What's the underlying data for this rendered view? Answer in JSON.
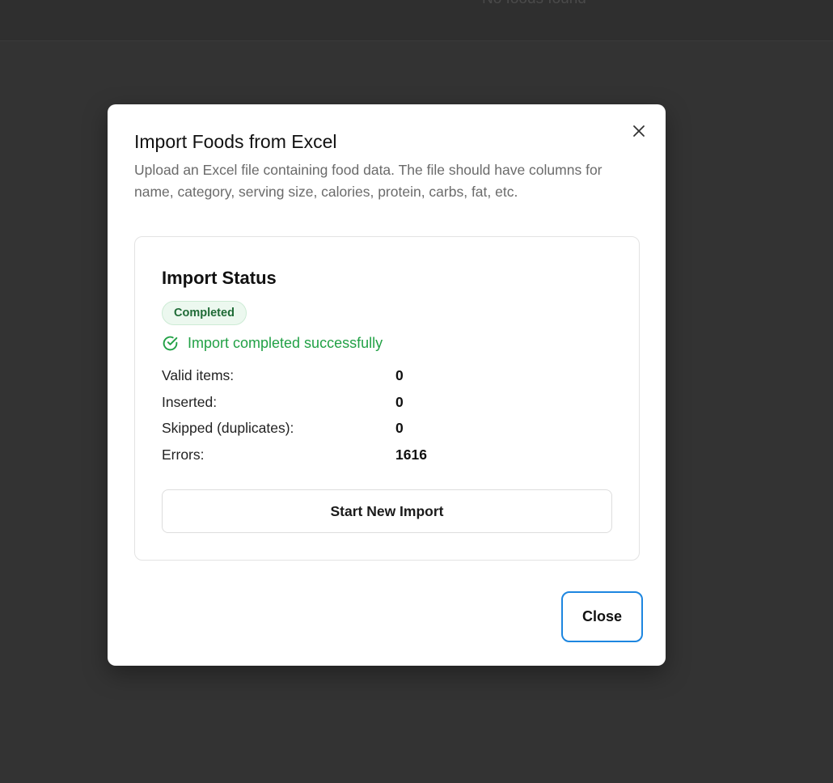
{
  "background": {
    "empty_text": "No foods found"
  },
  "dialog": {
    "title": "Import Foods from Excel",
    "description": "Upload an Excel file containing food data. The file should have columns for name, category, serving size, calories, protein, carbs, fat, etc.",
    "close_icon": "close-icon",
    "status_card": {
      "title": "Import Status",
      "badge": "Completed",
      "success_icon": "check-circle-icon",
      "success_message": "Import completed successfully",
      "stats": [
        {
          "label": "Valid items:",
          "value": "0"
        },
        {
          "label": "Inserted:",
          "value": "0"
        },
        {
          "label": "Skipped (duplicates):",
          "value": "0"
        },
        {
          "label": "Errors:",
          "value": "1616"
        }
      ],
      "new_import_label": "Start New Import"
    },
    "close_label": "Close"
  },
  "colors": {
    "success": "#22a146",
    "badge_bg": "#ecf8ef",
    "focus_ring": "#1d86e0"
  }
}
